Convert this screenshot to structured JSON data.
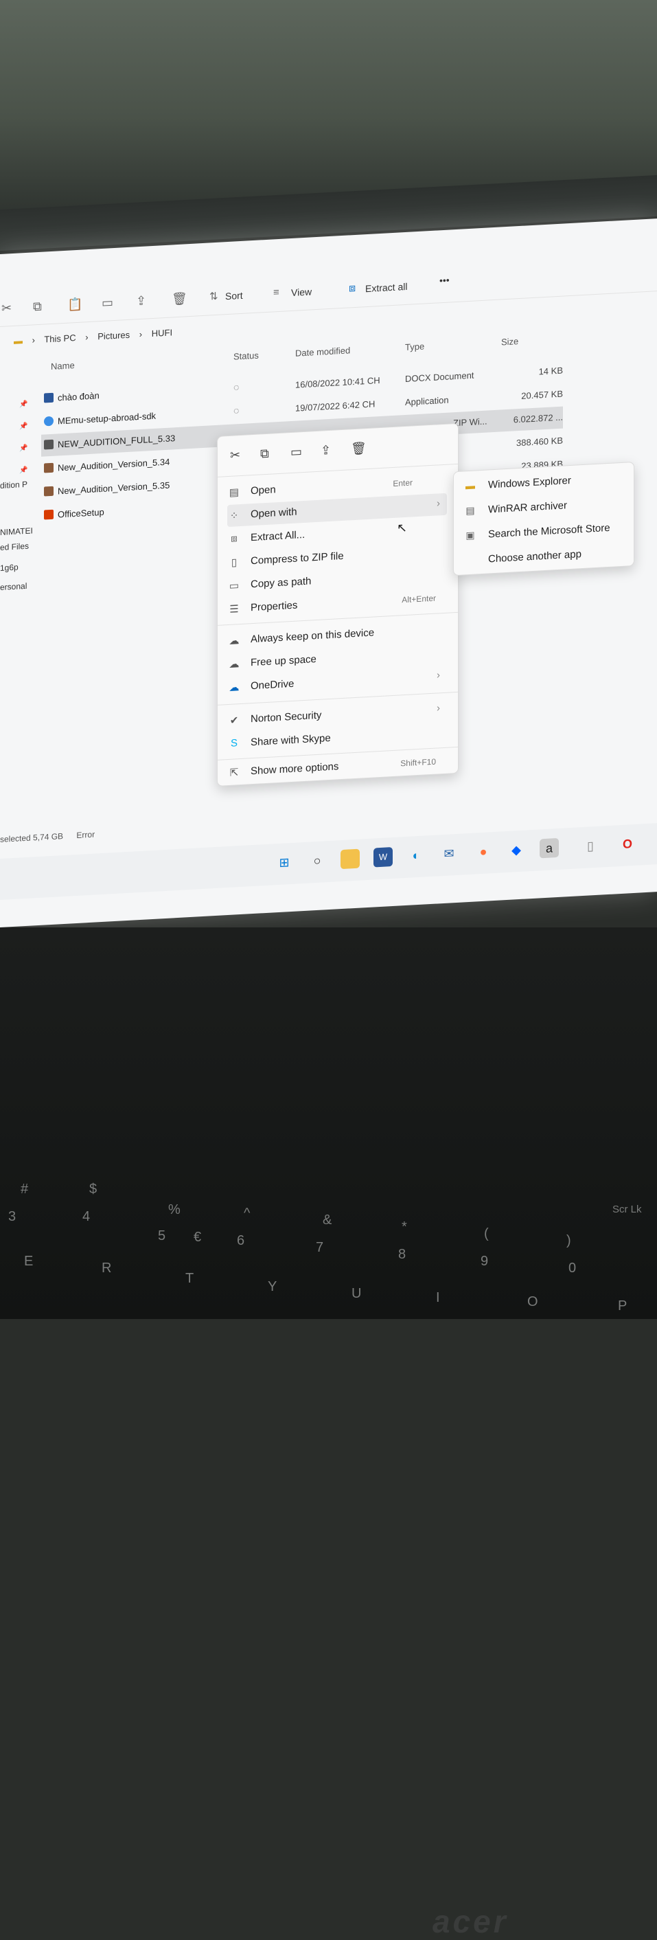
{
  "toolbar": {
    "sort_label": "Sort",
    "view_label": "View",
    "extract_all_label": "Extract all",
    "more_label": "•••"
  },
  "breadcrumb": [
    "This PC",
    "Pictures",
    "HUFI"
  ],
  "columns": {
    "name": "Name",
    "status": "Status",
    "date": "Date modified",
    "type": "Type",
    "size": "Size"
  },
  "nav_items": [
    "dition P",
    "NIMATEI",
    "ed Files",
    "1g6p",
    "ersonal"
  ],
  "files": [
    {
      "name": "chào đoàn",
      "date": "16/08/2022 10:41 CH",
      "type": "DOCX Document",
      "size": "14 KB",
      "status": "◌"
    },
    {
      "name": "MEmu-setup-abroad-sdk",
      "date": "19/07/2022 6:42 CH",
      "type": "Application",
      "size": "20.457 KB",
      "status": "◌"
    },
    {
      "name": "NEW_AUDITION_FULL_5.33",
      "date": "",
      "type": "ZIP Wi...",
      "size": "6.022.872 ...",
      "status": ""
    },
    {
      "name": "New_Audition_Version_5.34",
      "date": "",
      "type": "",
      "size": "388.460 KB",
      "status": ""
    },
    {
      "name": "New_Audition_Version_5.35",
      "date": "",
      "type": "",
      "size": "23.889 KB",
      "status": ""
    },
    {
      "name": "OfficeSetup",
      "date": "",
      "type": "",
      "size": "",
      "status": ""
    }
  ],
  "context_menu": {
    "open": {
      "label": "Open",
      "shortcut": "Enter"
    },
    "open_with": {
      "label": "Open with"
    },
    "extract_all": {
      "label": "Extract All..."
    },
    "compress_zip": {
      "label": "Compress to ZIP file"
    },
    "copy_as_path": {
      "label": "Copy as path"
    },
    "properties": {
      "label": "Properties",
      "shortcut": "Alt+Enter"
    },
    "always_keep": {
      "label": "Always keep on this device"
    },
    "free_up_space": {
      "label": "Free up space"
    },
    "onedrive": {
      "label": "OneDrive"
    },
    "norton": {
      "label": "Norton Security"
    },
    "skype": {
      "label": "Share with Skype"
    },
    "more_options": {
      "label": "Show more options",
      "shortcut": "Shift+F10"
    }
  },
  "open_with_submenu": [
    "Windows Explorer",
    "WinRAR archiver",
    "Search the Microsoft Store",
    "Choose another app"
  ],
  "statusbar": {
    "selected": "selected  5,74 GB",
    "error": "Error"
  },
  "laptop": {
    "brand": "acer"
  },
  "keys": [
    "#",
    "3",
    "$",
    "4",
    "%",
    "5",
    "€",
    "^",
    "6",
    "&",
    "7",
    "*",
    "8",
    "(",
    "9",
    ")",
    "0",
    "E",
    "R",
    "T",
    "Y",
    "U",
    "I",
    "O",
    "P",
    "Scr Lk"
  ],
  "colors": {
    "accent": "#0067c0",
    "selected_row": "#d9dadc",
    "menu_bg": "#f9f9f9"
  }
}
